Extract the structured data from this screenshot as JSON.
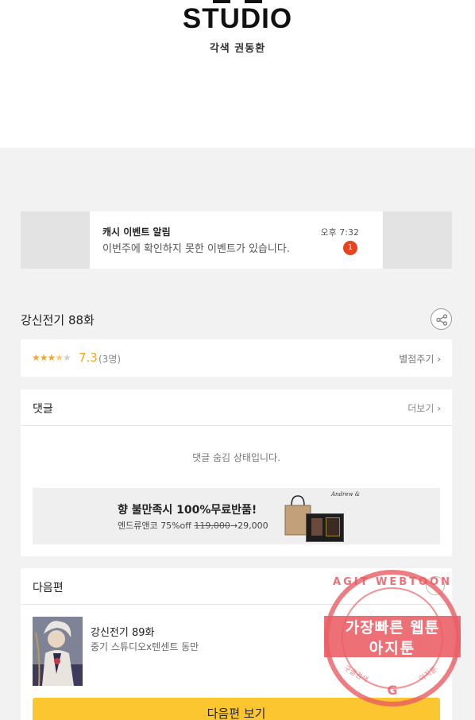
{
  "header": {
    "logo_text": "STUDIO",
    "credit": "각색 권동환"
  },
  "notification": {
    "title": "캐시 이벤트 알림",
    "message": "이번주에 확인하지 못한 이벤트가 있습니다.",
    "time": "오후 7:32",
    "badge_count": "1",
    "badge_color": "#e8431f"
  },
  "episode": {
    "title": "강신전기 88화",
    "share_icon": "share-icon"
  },
  "rating": {
    "stars_filled": 3.5,
    "stars_total": 5,
    "score": "7.3",
    "count": "(3명)",
    "rate_label": "별점주기 ›",
    "star_color": "#f5a623"
  },
  "comments": {
    "label": "댓글",
    "more_label": "더보기 ›",
    "hidden_message": "댓글 숨김 상태입니다."
  },
  "ad": {
    "title": "향 불만족시 100%무료반품!",
    "sub_prefix": "엔드류앤코 75%off ",
    "original_price": "119,000",
    "sale_price": "→29,000"
  },
  "next_episode": {
    "label": "다음편",
    "title": "강신전기 89화",
    "author": "중기 스튜디오x텐센트 동만",
    "button_label": "다음편 보기",
    "button_color": "#fcc630"
  },
  "watermark": {
    "arc_text": "AGIT WEBTOON",
    "line1": "가장빠른 웹툰",
    "line2": "아지툰",
    "left_text": "구글검색",
    "right_text": "아지툰",
    "logo_letter": "G"
  }
}
